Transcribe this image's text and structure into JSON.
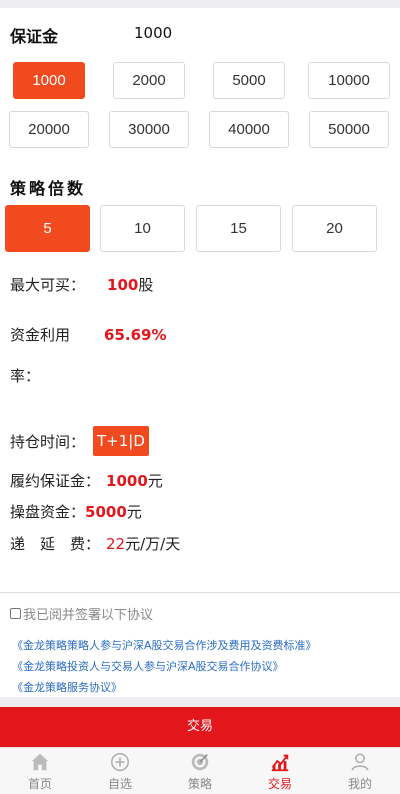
{
  "deposit": {
    "label": "保证金",
    "value": "1000"
  },
  "deposit_options": [
    {
      "label": "1000",
      "active": true
    },
    {
      "label": "2000",
      "active": false
    },
    {
      "label": "5000",
      "active": false
    },
    {
      "label": "10000",
      "active": false
    },
    {
      "label": "20000",
      "active": false
    },
    {
      "label": "30000",
      "active": false
    },
    {
      "label": "40000",
      "active": false
    },
    {
      "label": "50000",
      "active": false
    }
  ],
  "multiplier": {
    "title": "策略倍数",
    "options": [
      {
        "label": "5",
        "active": true
      },
      {
        "label": "10",
        "active": false
      },
      {
        "label": "15",
        "active": false
      },
      {
        "label": "20",
        "active": false
      }
    ]
  },
  "info": {
    "max_buy_label": "最大可买：",
    "max_buy_value": "100",
    "max_buy_unit": "股",
    "utilization_label_1": "资金利用",
    "utilization_label_2": "率：",
    "utilization_value": "65.69%",
    "hold_label": "持仓时间：",
    "hold_value": "T+1|D",
    "margin_label": "履约保证金：",
    "margin_value": "1000",
    "margin_unit": "元",
    "fund_label": "操盘资金：",
    "fund_value": "5000",
    "fund_unit": "元",
    "defer_label": "递　延　费：",
    "defer_value": "22",
    "defer_unit": "元/万/天"
  },
  "agreement": {
    "text": "我已阅并签署以下协议",
    "links": [
      "《金龙策略策略人参与沪深A股交易合作涉及费用及资费标准》",
      "《金龙策略投资人与交易人参与沪深A股交易合作协议》",
      "《金龙策略服务协议》"
    ]
  },
  "trade_button": "交易",
  "tabs": [
    {
      "label": "首页",
      "icon": "home-icon"
    },
    {
      "label": "自选",
      "icon": "plus-circle-icon"
    },
    {
      "label": "策略",
      "icon": "target-icon"
    },
    {
      "label": "交易",
      "icon": "chart-icon",
      "active": true
    },
    {
      "label": "我的",
      "icon": "user-icon"
    }
  ],
  "colors": {
    "accent": "#f14a1f",
    "red": "#e3161b",
    "link": "#2a6cc4"
  }
}
